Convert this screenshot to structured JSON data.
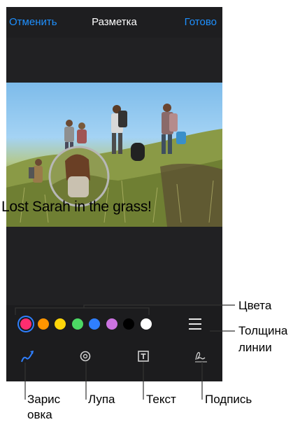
{
  "navbar": {
    "cancel_label": "Отменить",
    "title": "Разметка",
    "done_label": "Готово"
  },
  "photo": {
    "caption": "Lost Sarah in the grass!"
  },
  "palette": {
    "colors": [
      "#ff2d6f",
      "#ff9500",
      "#ffd60a",
      "#4cd964",
      "#2f7fff",
      "#cc73e1",
      "#000000",
      "#ffffff"
    ],
    "selected_index": 0
  },
  "tools": [
    {
      "name": "sketch-icon"
    },
    {
      "name": "loupe-icon"
    },
    {
      "name": "text-icon"
    },
    {
      "name": "signature-icon"
    }
  ],
  "annotations": {
    "colors": "Цвета",
    "thickness_line1": "Толщина",
    "thickness_line2": "линии",
    "sketch_line1": "Зарис",
    "sketch_line2": "овка",
    "loupe": "Лупа",
    "text": "Текст",
    "signature": "Подпись"
  }
}
